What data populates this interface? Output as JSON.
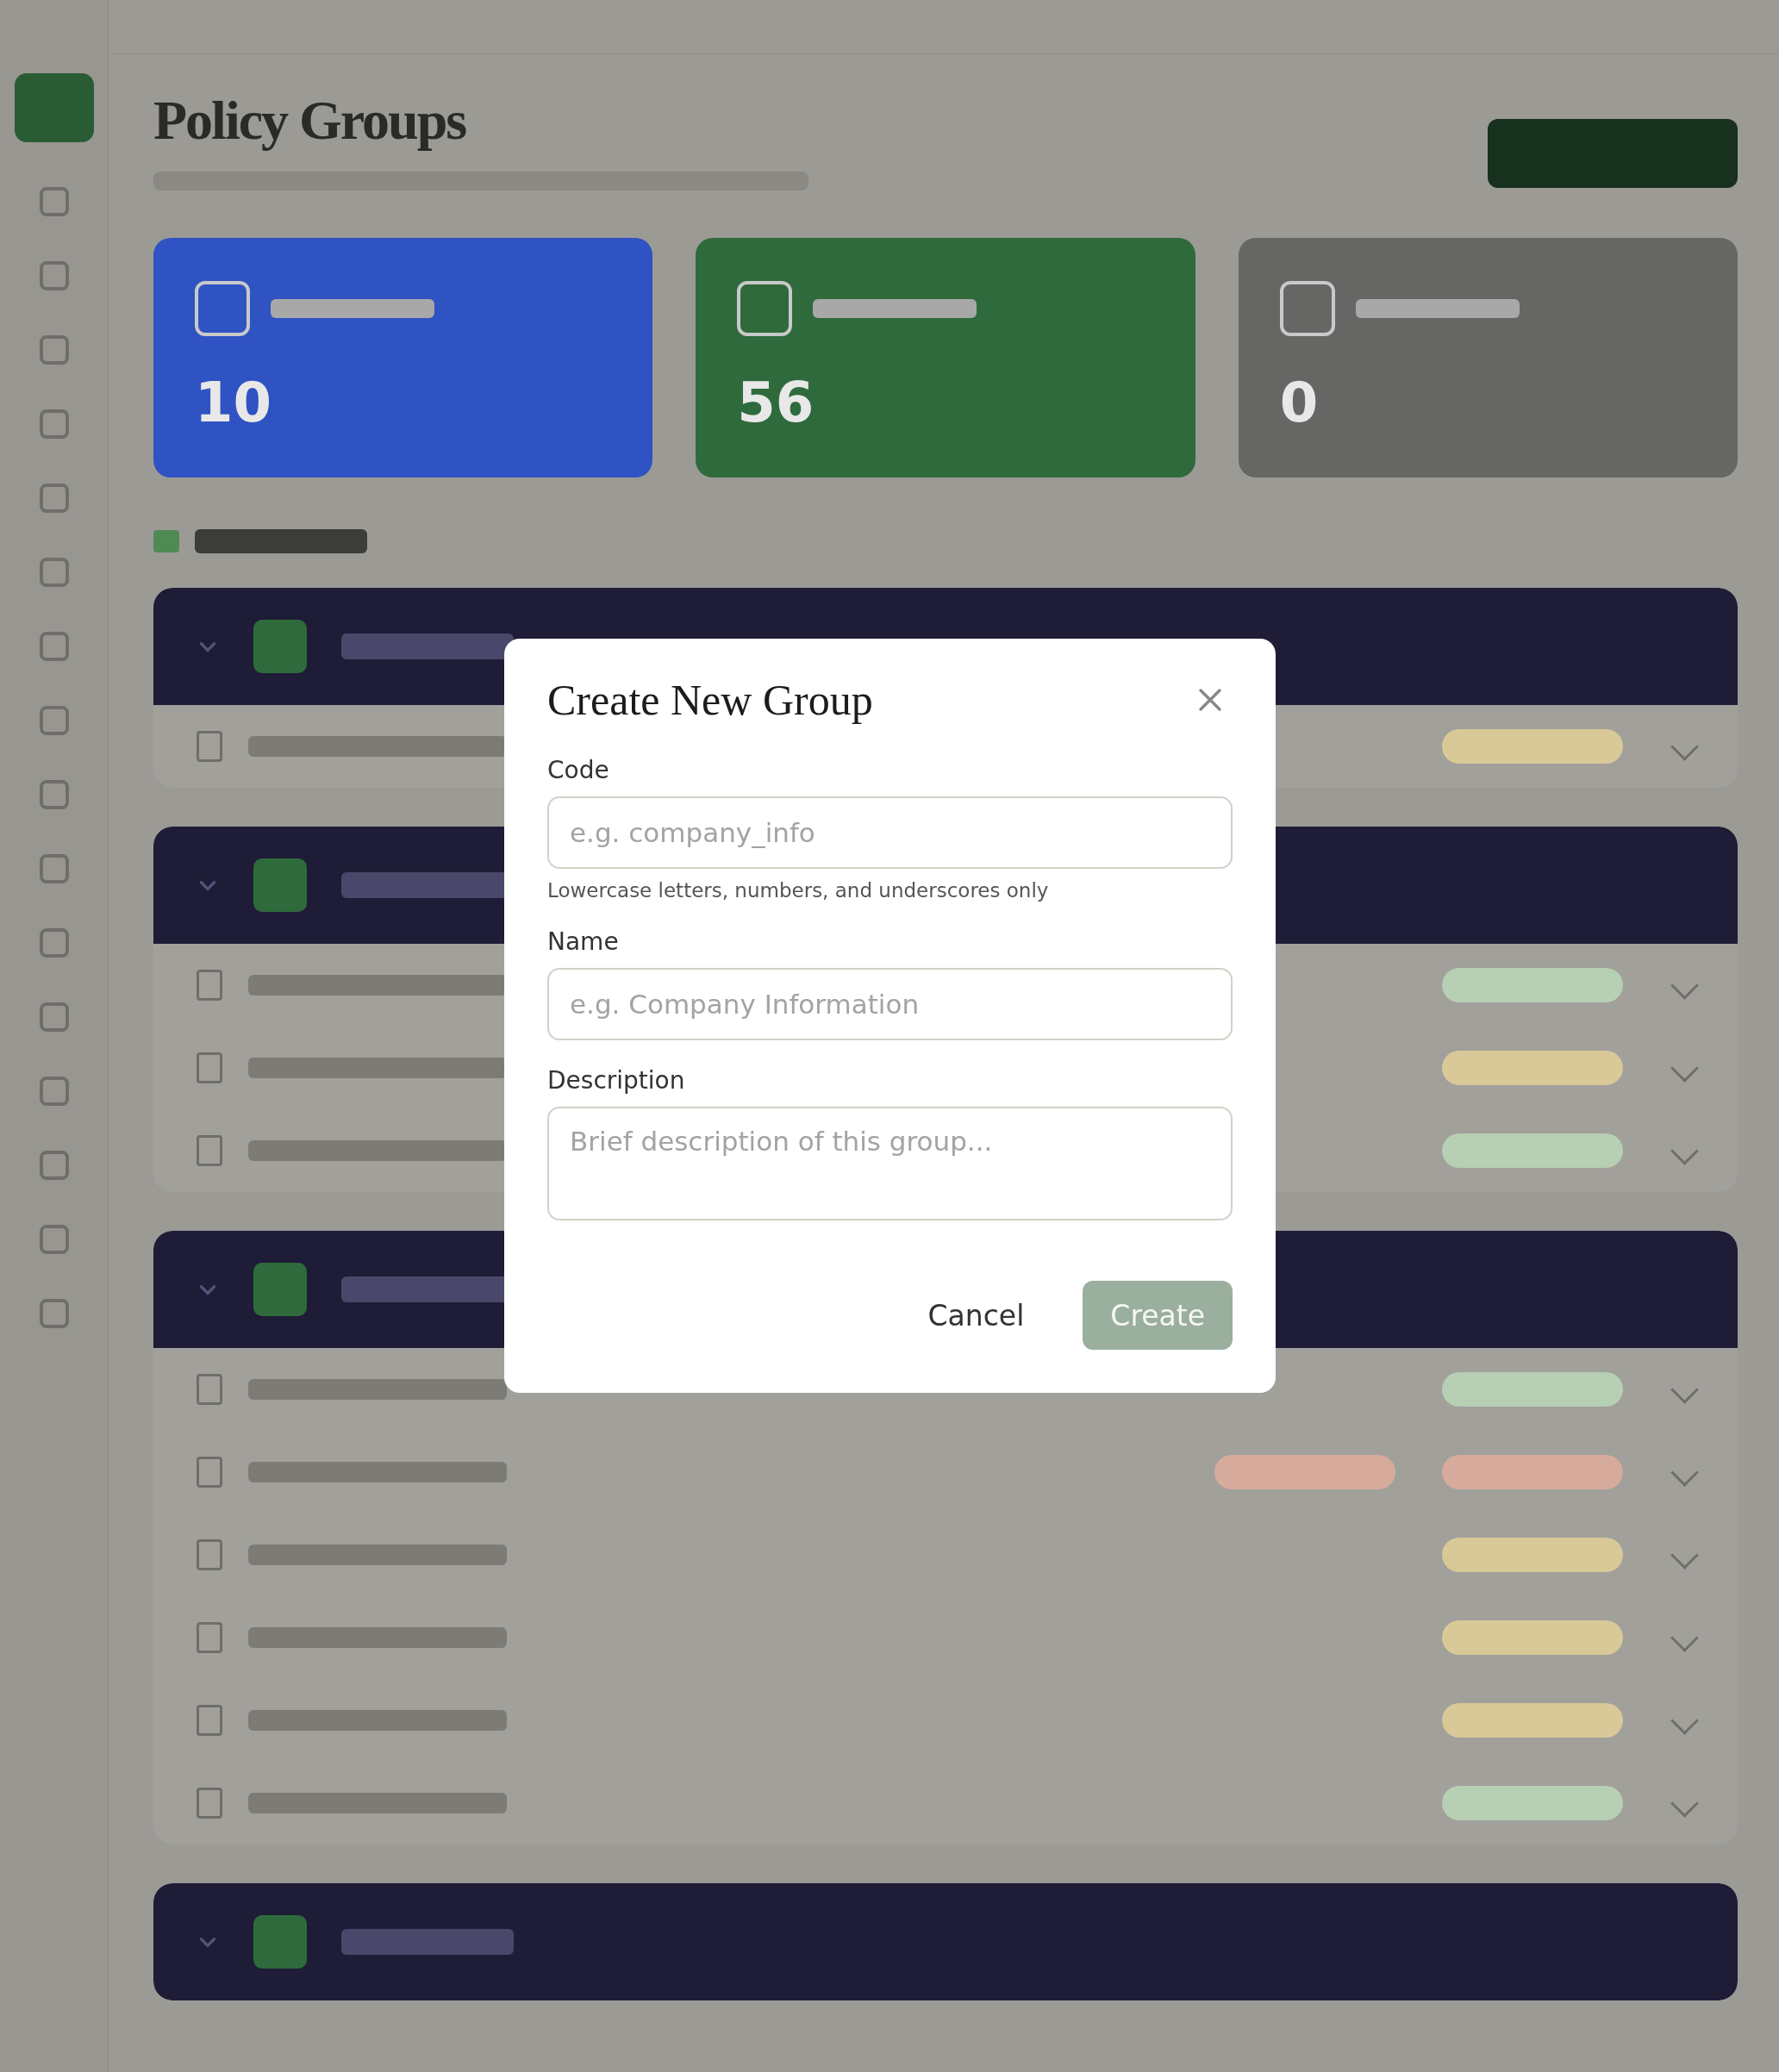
{
  "page": {
    "title": "Policy Groups",
    "stats": [
      {
        "value": "10",
        "color": "#2f53c2"
      },
      {
        "value": "56",
        "color": "#2f6a3c"
      },
      {
        "value": "0",
        "color": "#666664"
      }
    ],
    "groups": [
      {
        "expanded": true,
        "rows": [
          {
            "tags": [
              {
                "color": "#d9c999"
              }
            ]
          }
        ]
      },
      {
        "expanded": true,
        "rows": [
          {
            "tags": [
              {
                "color": "#b7cfb3"
              }
            ]
          },
          {
            "tags": [
              {
                "color": "#d9c999"
              }
            ]
          },
          {
            "tags": [
              {
                "color": "#b7cfb3"
              }
            ]
          }
        ]
      },
      {
        "expanded": true,
        "rows": [
          {
            "tags": [
              {
                "color": "#b7cfb3"
              }
            ]
          },
          {
            "tags": [
              {
                "color": "#d6ab9c"
              },
              {
                "color": "#d6ab9c"
              }
            ]
          },
          {
            "tags": [
              {
                "color": "#d9c999"
              }
            ]
          },
          {
            "tags": [
              {
                "color": "#d9c999"
              }
            ]
          },
          {
            "tags": [
              {
                "color": "#d9c999"
              }
            ]
          },
          {
            "tags": [
              {
                "color": "#b7cfb3"
              }
            ]
          }
        ]
      },
      {
        "expanded": true
      }
    ]
  },
  "dialog": {
    "title": "Create New Group",
    "fields": [
      {
        "kind": "input",
        "label": "Code",
        "placeholder": "e.g. company_info",
        "hint": "Lowercase letters, numbers, and underscores only"
      },
      {
        "kind": "input",
        "label": "Name",
        "placeholder": "e.g. Company Information"
      },
      {
        "kind": "textarea",
        "label": "Description",
        "placeholder": "Brief description of this group..."
      }
    ],
    "buttons": [
      {
        "kind": "secondary",
        "label": "Cancel",
        "disabled": false
      },
      {
        "kind": "primary",
        "label": "Create",
        "disabled": true
      }
    ]
  }
}
